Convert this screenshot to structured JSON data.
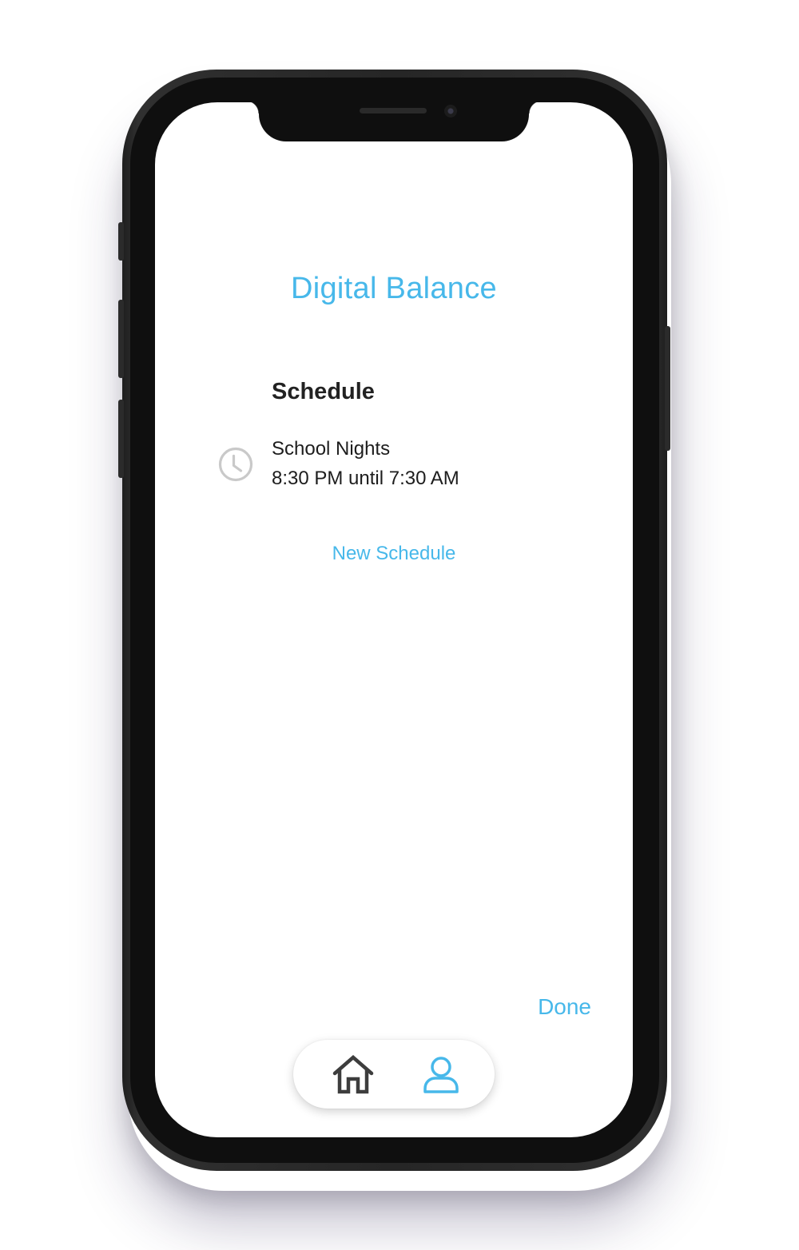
{
  "app": {
    "title": "Digital Balance"
  },
  "schedule_section": {
    "heading": "Schedule",
    "items": [
      {
        "icon": "clock-icon",
        "name": "School Nights",
        "time": "8:30 PM until 7:30 AM"
      }
    ],
    "new_label": "New Schedule"
  },
  "actions": {
    "done_label": "Done"
  },
  "tab_bar": {
    "tabs": [
      {
        "icon": "home-icon",
        "active": false
      },
      {
        "icon": "profile-icon",
        "active": true
      }
    ]
  },
  "colors": {
    "accent": "#47b8ea",
    "text": "#1d1d1d",
    "icon_inactive": "#3d3d3d",
    "icon_muted": "#c9c9c9"
  }
}
